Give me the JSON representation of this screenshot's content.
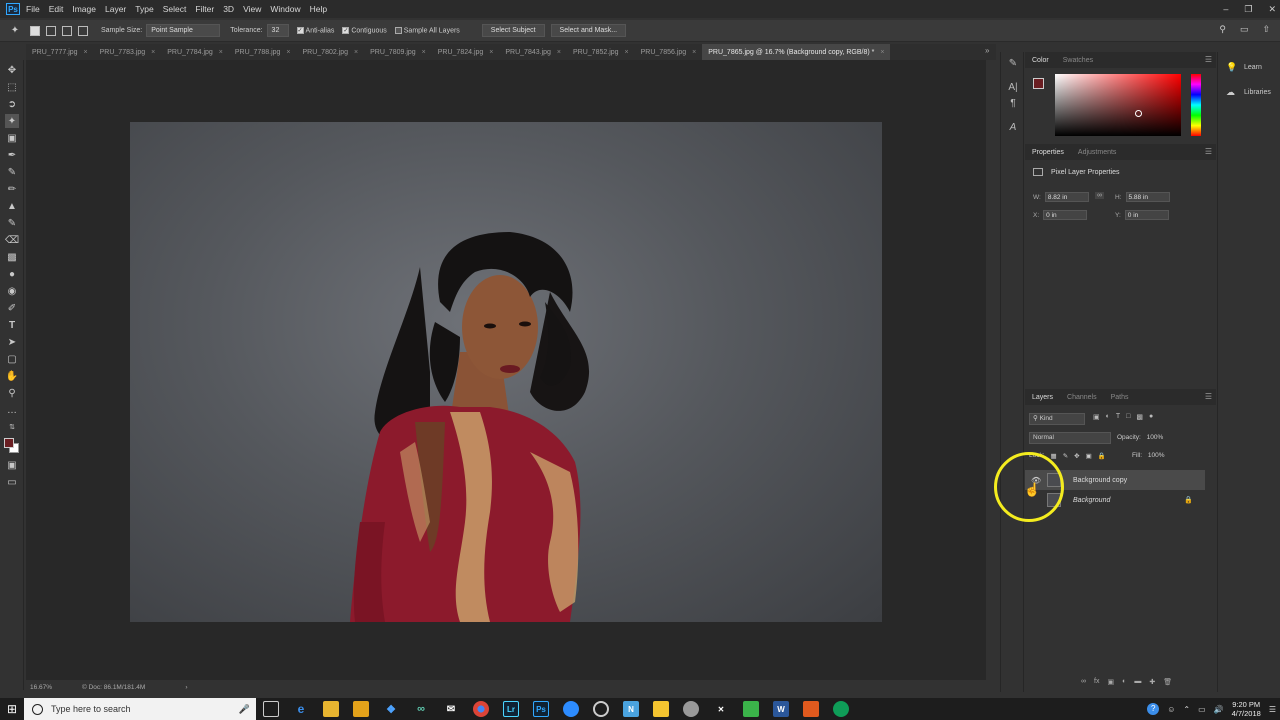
{
  "menubar": {
    "logo": "Ps",
    "items": [
      "File",
      "Edit",
      "Image",
      "Layer",
      "Type",
      "Select",
      "Filter",
      "3D",
      "View",
      "Window",
      "Help"
    ]
  },
  "options": {
    "sample_size_label": "Sample Size:",
    "sample_size_value": "Point Sample",
    "tolerance_label": "Tolerance:",
    "tolerance_value": "32",
    "anti_alias": "Anti-alias",
    "contiguous": "Contiguous",
    "sample_all_layers": "Sample All Layers",
    "select_subject": "Select Subject",
    "select_and_mask": "Select and Mask..."
  },
  "tabs": [
    {
      "label": "PRU_7777.jpg"
    },
    {
      "label": "PRU_7783.jpg"
    },
    {
      "label": "PRU_7784.jpg"
    },
    {
      "label": "PRU_7788.jpg"
    },
    {
      "label": "PRU_7802.jpg"
    },
    {
      "label": "PRU_7809.jpg"
    },
    {
      "label": "PRU_7824.jpg"
    },
    {
      "label": "PRU_7843.jpg"
    },
    {
      "label": "PRU_7852.jpg"
    },
    {
      "label": "PRU_7856.jpg"
    },
    {
      "label": "PRU_7865.jpg @ 16.7% (Background copy, RGB/8) *"
    }
  ],
  "status": {
    "zoom": "16.67%",
    "doc": "Doc: 86.1M/181.4M"
  },
  "color_panel": {
    "tabs": [
      "Color",
      "Swatches"
    ],
    "fg_color": "#6a1e22",
    "bg_color": "#ffffff"
  },
  "properties": {
    "tabs": [
      "Properties",
      "Adjustments"
    ],
    "title": "Pixel Layer Properties",
    "w_label": "W:",
    "w_value": "8.82 in",
    "h_label": "H:",
    "h_value": "5.88 in",
    "x_label": "X:",
    "x_value": "0 in",
    "y_label": "Y:",
    "y_value": "0 in"
  },
  "layers": {
    "tabs": [
      "Layers",
      "Channels",
      "Paths"
    ],
    "filter_kind": "Kind",
    "blend_mode": "Normal",
    "opacity_label": "Opacity:",
    "opacity_value": "100%",
    "lock_label": "Lock:",
    "fill_label": "Fill:",
    "fill_value": "100%",
    "items": [
      {
        "name": "Background copy"
      },
      {
        "name": "Background"
      }
    ]
  },
  "learn_panel": {
    "items": [
      "Learn",
      "Libraries"
    ]
  },
  "taskbar": {
    "search_placeholder": "Type here to search",
    "time": "9:20 PM",
    "date": "4/7/2018"
  }
}
